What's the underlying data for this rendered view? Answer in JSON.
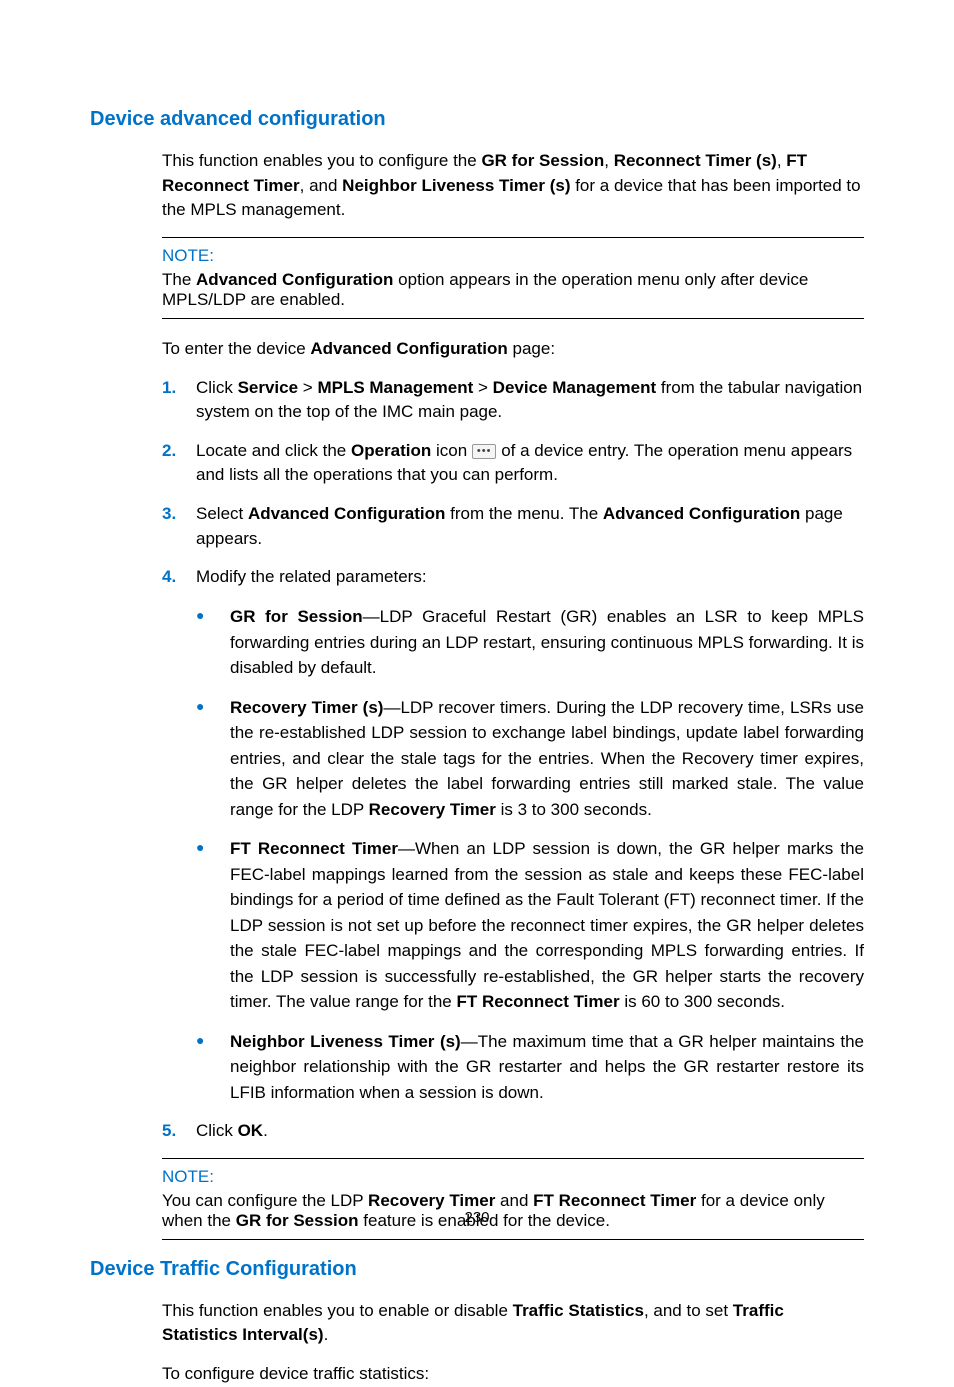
{
  "page_number": "230",
  "section1": {
    "heading": "Device advanced configuration",
    "intro": {
      "pre": "This function enables you to configure the ",
      "b1": "GR for Session",
      "s1": ", ",
      "b2": "Reconnect Timer (s)",
      "s2": ", ",
      "b3": "FT Reconnect Timer",
      "s3": ", and ",
      "b4": "Neighbor Liveness Timer (s)",
      "post": " for a device that has been imported to the MPLS management."
    },
    "note1": {
      "label": "NOTE:",
      "pre": "The ",
      "b": "Advanced Configuration",
      "post": " option appears in the operation menu only after device MPLS/LDP are enabled."
    },
    "lead_in": {
      "pre": "To enter the device ",
      "b": "Advanced Configuration",
      "post": " page:"
    },
    "steps": [
      {
        "n": "1.",
        "pre": "Click ",
        "b1": "Service",
        "s1": " > ",
        "b2": "MPLS Management",
        "s2": " > ",
        "b3": "Device Management",
        "post": " from the tabular navigation system on the top of the IMC main page."
      },
      {
        "n": "2.",
        "pre": "Locate and click the ",
        "b1": "Operation",
        "mid": " icon ",
        "post": " of a device entry. The operation menu appears and lists all the operations that you can perform."
      },
      {
        "n": "3.",
        "pre": "Select ",
        "b1": "Advanced Configuration",
        "mid": " from the menu. The ",
        "b2": "Advanced Configuration",
        "post": " page appears."
      },
      {
        "n": "4.",
        "text": "Modify the related parameters:"
      },
      {
        "n": "5.",
        "pre": "Click ",
        "b1": "OK",
        "post": "."
      }
    ],
    "bullets": [
      {
        "b": "GR for Session",
        "text": "—LDP Graceful Restart (GR) enables an LSR to keep MPLS forwarding entries during an LDP restart, ensuring continuous MPLS forwarding. It is disabled by default."
      },
      {
        "b": "Recovery Timer (s)",
        "text1": "—LDP recover timers. During the LDP recovery time, LSRs use the re-established LDP session to exchange label bindings, update label forwarding entries, and clear the stale tags for the entries. When the Recovery timer expires, the GR helper deletes the label forwarding entries still marked stale. The value range for the LDP ",
        "b2": "Recovery Timer",
        "text2": " is 3 to 300 seconds."
      },
      {
        "b": "FT Reconnect Timer",
        "text1": "—When an LDP session is down, the GR helper marks the FEC-label mappings learned from the session as stale and keeps these FEC-label bindings for a period of time defined as the Fault Tolerant (FT) reconnect timer. If the LDP session is not set up before the reconnect timer expires, the GR helper deletes the stale FEC-label mappings and the corresponding MPLS forwarding entries. If the LDP session is successfully re-established, the GR helper starts the recovery timer. The value range for the ",
        "b2": "FT Reconnect Timer",
        "text2": " is 60 to 300 seconds."
      },
      {
        "b": "Neighbor Liveness Timer (s)",
        "text": "—The maximum time that a GR helper maintains the neighbor relationship with the GR restarter and helps the GR restarter restore its LFIB information when a session is down."
      }
    ],
    "note2": {
      "label": "NOTE:",
      "pre": "You can configure the LDP ",
      "b1": "Recovery Timer",
      "s1": " and ",
      "b2": "FT Reconnect Timer",
      "s2": " for a device only when the ",
      "b3": "GR for Session",
      "post": " feature is enabled for the device."
    }
  },
  "section2": {
    "heading": "Device Traffic Configuration",
    "intro": {
      "pre": "This function enables you to enable or disable ",
      "b1": "Traffic Statistics",
      "s1": ", and to set ",
      "b2": "Traffic Statistics Interval(s)",
      "post": "."
    },
    "lead_in": "To configure device traffic statistics:"
  }
}
